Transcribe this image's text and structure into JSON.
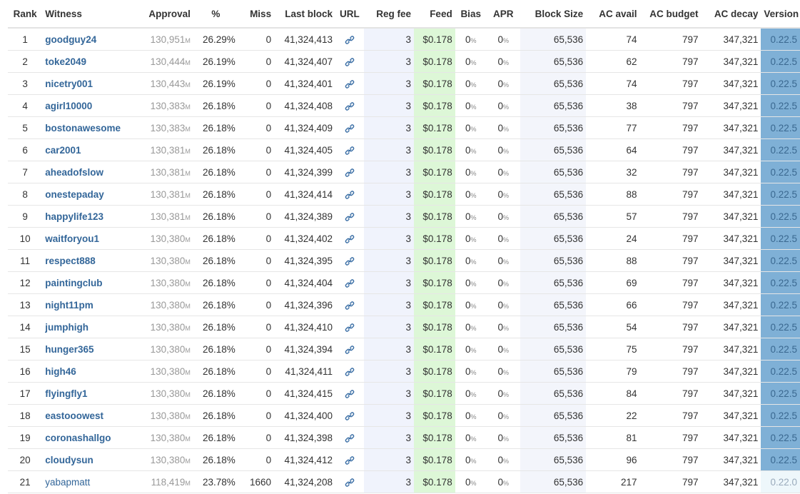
{
  "headers": {
    "rank": "Rank",
    "witness": "Witness",
    "approval": "Approval",
    "pct": "%",
    "miss": "Miss",
    "last_block": "Last block",
    "url": "URL",
    "reg_fee": "Reg fee",
    "feed": "Feed",
    "bias": "Bias",
    "apr": "APR",
    "block_size": "Block Size",
    "ac_avail": "AC avail",
    "ac_budget": "AC budget",
    "ac_decay": "AC decay",
    "version": "Version"
  },
  "unit_m": "M",
  "pct_unit": "%",
  "link_icon": "link-icon",
  "colors": {
    "witness_link": "#336699",
    "feed_bg": "#ddf7d7",
    "version_bg": "#7fb0d6",
    "reg_fee_bg": "#f0f3fc"
  },
  "rows": [
    {
      "rank": "1",
      "witness": "goodguy24",
      "approval": "130,951",
      "pct": "26.29%",
      "miss": "0",
      "last_block": "41,324,413",
      "reg_fee": "3",
      "feed": "$0.178",
      "bias": "0",
      "apr": "0",
      "block_size": "65,536",
      "ac_avail": "74",
      "ac_budget": "797",
      "ac_decay": "347,321",
      "version": "0.22.5",
      "active": true
    },
    {
      "rank": "2",
      "witness": "toke2049",
      "approval": "130,444",
      "pct": "26.19%",
      "miss": "0",
      "last_block": "41,324,407",
      "reg_fee": "3",
      "feed": "$0.178",
      "bias": "0",
      "apr": "0",
      "block_size": "65,536",
      "ac_avail": "62",
      "ac_budget": "797",
      "ac_decay": "347,321",
      "version": "0.22.5",
      "active": true
    },
    {
      "rank": "3",
      "witness": "nicetry001",
      "approval": "130,443",
      "pct": "26.19%",
      "miss": "0",
      "last_block": "41,324,401",
      "reg_fee": "3",
      "feed": "$0.178",
      "bias": "0",
      "apr": "0",
      "block_size": "65,536",
      "ac_avail": "74",
      "ac_budget": "797",
      "ac_decay": "347,321",
      "version": "0.22.5",
      "active": true
    },
    {
      "rank": "4",
      "witness": "agirl10000",
      "approval": "130,383",
      "pct": "26.18%",
      "miss": "0",
      "last_block": "41,324,408",
      "reg_fee": "3",
      "feed": "$0.178",
      "bias": "0",
      "apr": "0",
      "block_size": "65,536",
      "ac_avail": "38",
      "ac_budget": "797",
      "ac_decay": "347,321",
      "version": "0.22.5",
      "active": true
    },
    {
      "rank": "5",
      "witness": "bostonawesome",
      "approval": "130,383",
      "pct": "26.18%",
      "miss": "0",
      "last_block": "41,324,409",
      "reg_fee": "3",
      "feed": "$0.178",
      "bias": "0",
      "apr": "0",
      "block_size": "65,536",
      "ac_avail": "77",
      "ac_budget": "797",
      "ac_decay": "347,321",
      "version": "0.22.5",
      "active": true
    },
    {
      "rank": "6",
      "witness": "car2001",
      "approval": "130,381",
      "pct": "26.18%",
      "miss": "0",
      "last_block": "41,324,405",
      "reg_fee": "3",
      "feed": "$0.178",
      "bias": "0",
      "apr": "0",
      "block_size": "65,536",
      "ac_avail": "64",
      "ac_budget": "797",
      "ac_decay": "347,321",
      "version": "0.22.5",
      "active": true
    },
    {
      "rank": "7",
      "witness": "aheadofslow",
      "approval": "130,381",
      "pct": "26.18%",
      "miss": "0",
      "last_block": "41,324,399",
      "reg_fee": "3",
      "feed": "$0.178",
      "bias": "0",
      "apr": "0",
      "block_size": "65,536",
      "ac_avail": "32",
      "ac_budget": "797",
      "ac_decay": "347,321",
      "version": "0.22.5",
      "active": true
    },
    {
      "rank": "8",
      "witness": "onestepaday",
      "approval": "130,381",
      "pct": "26.18%",
      "miss": "0",
      "last_block": "41,324,414",
      "reg_fee": "3",
      "feed": "$0.178",
      "bias": "0",
      "apr": "0",
      "block_size": "65,536",
      "ac_avail": "88",
      "ac_budget": "797",
      "ac_decay": "347,321",
      "version": "0.22.5",
      "active": true
    },
    {
      "rank": "9",
      "witness": "happylife123",
      "approval": "130,381",
      "pct": "26.18%",
      "miss": "0",
      "last_block": "41,324,389",
      "reg_fee": "3",
      "feed": "$0.178",
      "bias": "0",
      "apr": "0",
      "block_size": "65,536",
      "ac_avail": "57",
      "ac_budget": "797",
      "ac_decay": "347,321",
      "version": "0.22.5",
      "active": true
    },
    {
      "rank": "10",
      "witness": "waitforyou1",
      "approval": "130,380",
      "pct": "26.18%",
      "miss": "0",
      "last_block": "41,324,402",
      "reg_fee": "3",
      "feed": "$0.178",
      "bias": "0",
      "apr": "0",
      "block_size": "65,536",
      "ac_avail": "24",
      "ac_budget": "797",
      "ac_decay": "347,321",
      "version": "0.22.5",
      "active": true
    },
    {
      "rank": "11",
      "witness": "respect888",
      "approval": "130,380",
      "pct": "26.18%",
      "miss": "0",
      "last_block": "41,324,395",
      "reg_fee": "3",
      "feed": "$0.178",
      "bias": "0",
      "apr": "0",
      "block_size": "65,536",
      "ac_avail": "88",
      "ac_budget": "797",
      "ac_decay": "347,321",
      "version": "0.22.5",
      "active": true
    },
    {
      "rank": "12",
      "witness": "paintingclub",
      "approval": "130,380",
      "pct": "26.18%",
      "miss": "0",
      "last_block": "41,324,404",
      "reg_fee": "3",
      "feed": "$0.178",
      "bias": "0",
      "apr": "0",
      "block_size": "65,536",
      "ac_avail": "69",
      "ac_budget": "797",
      "ac_decay": "347,321",
      "version": "0.22.5",
      "active": true
    },
    {
      "rank": "13",
      "witness": "night11pm",
      "approval": "130,380",
      "pct": "26.18%",
      "miss": "0",
      "last_block": "41,324,396",
      "reg_fee": "3",
      "feed": "$0.178",
      "bias": "0",
      "apr": "0",
      "block_size": "65,536",
      "ac_avail": "66",
      "ac_budget": "797",
      "ac_decay": "347,321",
      "version": "0.22.5",
      "active": true
    },
    {
      "rank": "14",
      "witness": "jumphigh",
      "approval": "130,380",
      "pct": "26.18%",
      "miss": "0",
      "last_block": "41,324,410",
      "reg_fee": "3",
      "feed": "$0.178",
      "bias": "0",
      "apr": "0",
      "block_size": "65,536",
      "ac_avail": "54",
      "ac_budget": "797",
      "ac_decay": "347,321",
      "version": "0.22.5",
      "active": true
    },
    {
      "rank": "15",
      "witness": "hunger365",
      "approval": "130,380",
      "pct": "26.18%",
      "miss": "0",
      "last_block": "41,324,394",
      "reg_fee": "3",
      "feed": "$0.178",
      "bias": "0",
      "apr": "0",
      "block_size": "65,536",
      "ac_avail": "75",
      "ac_budget": "797",
      "ac_decay": "347,321",
      "version": "0.22.5",
      "active": true
    },
    {
      "rank": "16",
      "witness": "high46",
      "approval": "130,380",
      "pct": "26.18%",
      "miss": "0",
      "last_block": "41,324,411",
      "reg_fee": "3",
      "feed": "$0.178",
      "bias": "0",
      "apr": "0",
      "block_size": "65,536",
      "ac_avail": "79",
      "ac_budget": "797",
      "ac_decay": "347,321",
      "version": "0.22.5",
      "active": true
    },
    {
      "rank": "17",
      "witness": "flyingfly1",
      "approval": "130,380",
      "pct": "26.18%",
      "miss": "0",
      "last_block": "41,324,415",
      "reg_fee": "3",
      "feed": "$0.178",
      "bias": "0",
      "apr": "0",
      "block_size": "65,536",
      "ac_avail": "84",
      "ac_budget": "797",
      "ac_decay": "347,321",
      "version": "0.22.5",
      "active": true
    },
    {
      "rank": "18",
      "witness": "eastooowest",
      "approval": "130,380",
      "pct": "26.18%",
      "miss": "0",
      "last_block": "41,324,400",
      "reg_fee": "3",
      "feed": "$0.178",
      "bias": "0",
      "apr": "0",
      "block_size": "65,536",
      "ac_avail": "22",
      "ac_budget": "797",
      "ac_decay": "347,321",
      "version": "0.22.5",
      "active": true
    },
    {
      "rank": "19",
      "witness": "coronashallgo",
      "approval": "130,380",
      "pct": "26.18%",
      "miss": "0",
      "last_block": "41,324,398",
      "reg_fee": "3",
      "feed": "$0.178",
      "bias": "0",
      "apr": "0",
      "block_size": "65,536",
      "ac_avail": "81",
      "ac_budget": "797",
      "ac_decay": "347,321",
      "version": "0.22.5",
      "active": true
    },
    {
      "rank": "20",
      "witness": "cloudysun",
      "approval": "130,380",
      "pct": "26.18%",
      "miss": "0",
      "last_block": "41,324,412",
      "reg_fee": "3",
      "feed": "$0.178",
      "bias": "0",
      "apr": "0",
      "block_size": "65,536",
      "ac_avail": "96",
      "ac_budget": "797",
      "ac_decay": "347,321",
      "version": "0.22.5",
      "active": true
    },
    {
      "rank": "21",
      "witness": "yabapmatt",
      "approval": "118,419",
      "pct": "23.78%",
      "miss": "1660",
      "last_block": "41,324,208",
      "reg_fee": "3",
      "feed": "$0.178",
      "bias": "0",
      "apr": "0",
      "block_size": "65,536",
      "ac_avail": "217",
      "ac_budget": "797",
      "ac_decay": "347,321",
      "version": "0.22.0",
      "active": false
    }
  ]
}
